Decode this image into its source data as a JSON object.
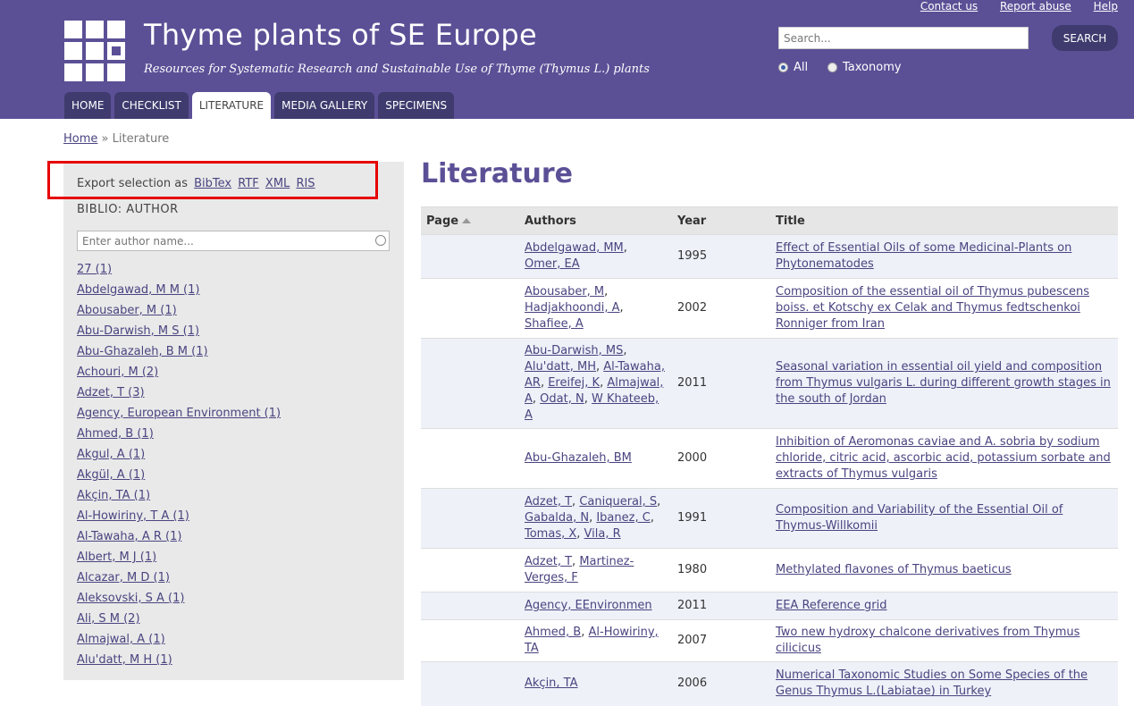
{
  "top_links": [
    "Contact us",
    "Report abuse",
    "Help"
  ],
  "site": {
    "title": "Thyme plants of SE Europe",
    "slogan": "Resources for Systematic Research and Sustainable Use of Thyme (Thymus L.) plants"
  },
  "search": {
    "placeholder": "Search...",
    "button": "SEARCH",
    "options": [
      "All",
      "Taxonomy"
    ],
    "selected": "All"
  },
  "tabs": [
    "HOME",
    "CHECKLIST",
    "LITERATURE",
    "MEDIA GALLERY",
    "SPECIMENS"
  ],
  "active_tab": "LITERATURE",
  "breadcrumb": {
    "home": "Home",
    "separator": "»",
    "current": "Literature"
  },
  "sidebar": {
    "export_label": "Export selection as",
    "export_formats": [
      "BibTex",
      "RTF",
      "XML",
      "RIS"
    ],
    "facet_title": "BIBLIO: AUTHOR",
    "author_placeholder": "Enter author name...",
    "authors": [
      "27 (1)",
      "Abdelgawad, M M (1)",
      "Abousaber, M (1)",
      "Abu-Darwish, M S (1)",
      "Abu-Ghazaleh, B M (1)",
      "Achouri, M (2)",
      "Adzet, T (3)",
      "Agency, European Environment (1)",
      "Ahmed, B (1)",
      "Akgul, A (1)",
      "Akgül, A (1)",
      "Akçin, TA (1)",
      "Al-Howiriny, T A (1)",
      "Al-Tawaha, A R (1)",
      "Albert, M J (1)",
      "Alcazar, M D (1)",
      "Aleksovski, S A (1)",
      "Ali, S M (2)",
      "Almajwal, A (1)",
      "Alu'datt, M H (1)"
    ]
  },
  "main": {
    "title": "Literature",
    "columns": [
      "Page",
      "Authors",
      "Year",
      "Title"
    ],
    "rows": [
      {
        "authors": [
          "Abdelgawad, MM",
          "Omer, EA"
        ],
        "year": "1995",
        "title": "Effect of Essential Oils of some Medicinal-Plants on Phytonematodes"
      },
      {
        "authors": [
          "Abousaber, M",
          "Hadjakhoondi, A",
          "Shafiee, A"
        ],
        "year": "2002",
        "title": "Composition of the essential oil of Thymus pubescens boiss. et Kotschy ex Celak and Thymus fedtschenkoi Ronniger from Iran"
      },
      {
        "authors": [
          "Abu-Darwish, MS",
          "Alu'datt, MH",
          "Al-Tawaha, AR",
          "Ereifej, K",
          "Almajwal, A",
          "Odat, N",
          "W Khateeb, A"
        ],
        "year": "2011",
        "title": "Seasonal variation in essential oil yield and composition from Thymus vulgaris L. during different growth stages in the south of Jordan"
      },
      {
        "authors": [
          "Abu-Ghazaleh, BM"
        ],
        "year": "2000",
        "title": "Inhibition of Aeromonas caviae and A. sobria by sodium chloride, citric acid, ascorbic acid, potassium sorbate and extracts of Thymus vulgaris"
      },
      {
        "authors": [
          "Adzet, T",
          "Caniqueral, S",
          "Gabalda, N",
          "Ibanez, C",
          "Tomas, X",
          "Vila, R"
        ],
        "year": "1991",
        "title": "Composition and Variability of the Essential Oil of Thymus-Willkomii"
      },
      {
        "authors": [
          "Adzet, T",
          "Martinez-Verges, F"
        ],
        "year": "1980",
        "title": "Methylated flavones of Thymus baeticus"
      },
      {
        "authors": [
          "Agency, EEnvironmen"
        ],
        "year": "2011",
        "title": "EEA Reference grid"
      },
      {
        "authors": [
          "Ahmed, B",
          "Al-Howiriny, TA"
        ],
        "year": "2007",
        "title": "Two new hydroxy chalcone derivatives from Thymus cilicicus"
      },
      {
        "authors": [
          "Akçin, TA"
        ],
        "year": "2006",
        "title": "Numerical Taxonomic Studies on Some Species of the Genus Thymus L.(Labiatae) in Turkey"
      }
    ]
  }
}
